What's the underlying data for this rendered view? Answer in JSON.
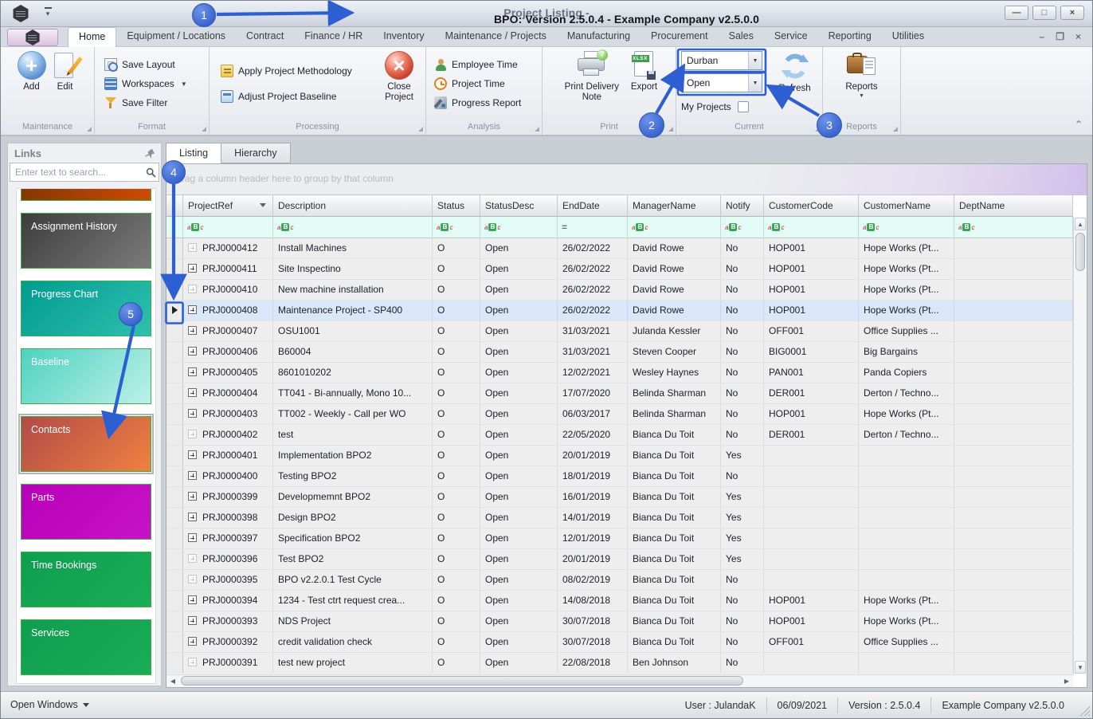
{
  "titlebar": {
    "title_prefix": "Project Listing - ",
    "title_main": "BPO: Version 2.5.0.4 - Example Company v2.5.0.0"
  },
  "ribbon_tabs": [
    {
      "label": "Home",
      "active": true
    },
    {
      "label": "Equipment / Locations"
    },
    {
      "label": "Contract"
    },
    {
      "label": "Finance / HR"
    },
    {
      "label": "Inventory"
    },
    {
      "label": "Maintenance / Projects"
    },
    {
      "label": "Manufacturing"
    },
    {
      "label": "Procurement"
    },
    {
      "label": "Sales"
    },
    {
      "label": "Service"
    },
    {
      "label": "Reporting"
    },
    {
      "label": "Utilities"
    }
  ],
  "ribbon": {
    "maintenance": {
      "label": "Maintenance",
      "add": "Add",
      "edit": "Edit"
    },
    "format": {
      "label": "Format",
      "save_layout": "Save Layout",
      "workspaces": "Workspaces",
      "save_filter": "Save Filter"
    },
    "processing": {
      "label": "Processing",
      "apply": "Apply Project Methodology",
      "adjust": "Adjust Project Baseline",
      "close_project": "Close Project"
    },
    "analysis": {
      "label": "Analysis",
      "employee_time": "Employee Time",
      "project_time": "Project Time",
      "progress_report": "Progress Report"
    },
    "print": {
      "label": "Print",
      "print_delivery": "Print Delivery Note",
      "export": "Export",
      "export_badge": "XLSX"
    },
    "current": {
      "label": "Current",
      "site_value": "Durban",
      "status_value": "Open",
      "my_projects": "My Projects",
      "refresh": "Refresh"
    },
    "reports": {
      "label": "Reports",
      "button": "Reports"
    }
  },
  "sidebar": {
    "title": "Links",
    "search_placeholder": "Enter text to search...",
    "tiles": [
      {
        "label": "",
        "color_from": "#833800",
        "color_to": "#cf4a05",
        "partial": true
      },
      {
        "label": "Assignment History",
        "color_from": "#3d3d3d",
        "color_to": "#7b7b7b"
      },
      {
        "label": "Progress Chart",
        "color_from": "#009c8f",
        "color_to": "#2fbfae"
      },
      {
        "label": "Baseline",
        "color_from": "#4ed2c0",
        "color_to": "#bdf0e8"
      },
      {
        "label": "Contacts",
        "color_from": "#b34a49",
        "color_to": "#ef813f",
        "selected": true
      },
      {
        "label": "Parts",
        "color_from": "#b800b8",
        "color_to": "#c713c7"
      },
      {
        "label": "Time Bookings",
        "color_from": "#0f9e4e",
        "color_to": "#1aac59"
      },
      {
        "label": "Services",
        "color_from": "#0f9e4e",
        "color_to": "#1aac59"
      }
    ]
  },
  "doc_tabs": {
    "listing": "Listing",
    "hierarchy": "Hierarchy"
  },
  "grid": {
    "group_hint": "Drag a column header here to group by that column",
    "columns": [
      {
        "key": "ref",
        "label": "ProjectRef",
        "sorted": true,
        "filter": "abc"
      },
      {
        "key": "desc",
        "label": "Description",
        "filter": "abc"
      },
      {
        "key": "status",
        "label": "Status",
        "filter": "abc"
      },
      {
        "key": "sdesc",
        "label": "StatusDesc",
        "filter": "abc"
      },
      {
        "key": "edate",
        "label": "EndDate",
        "filter": "eq"
      },
      {
        "key": "mgr",
        "label": "ManagerName",
        "filter": "abc"
      },
      {
        "key": "notify",
        "label": "Notify",
        "filter": "abc"
      },
      {
        "key": "ccode",
        "label": "CustomerCode",
        "filter": "abc"
      },
      {
        "key": "cname",
        "label": "CustomerName",
        "filter": "abc"
      },
      {
        "key": "dept",
        "label": "DeptName",
        "filter": "abc"
      }
    ],
    "rows": [
      {
        "expand": "light",
        "ref": "PRJ0000412",
        "desc": "Install Machines",
        "status": "O",
        "sdesc": "Open",
        "edate": "26/02/2022",
        "mgr": "David Rowe",
        "notify": "No",
        "ccode": "HOP001",
        "cname": "Hope Works (Pt...",
        "dept": "",
        "selected": false
      },
      {
        "expand": "dark",
        "ref": "PRJ0000411",
        "desc": "Site Inspectino",
        "status": "O",
        "sdesc": "Open",
        "edate": "26/02/2022",
        "mgr": "David Rowe",
        "notify": "No",
        "ccode": "HOP001",
        "cname": "Hope Works (Pt...",
        "dept": "",
        "selected": false
      },
      {
        "expand": "light",
        "ref": "PRJ0000410",
        "desc": "New machine installation",
        "status": "O",
        "sdesc": "Open",
        "edate": "26/02/2022",
        "mgr": "David Rowe",
        "notify": "No",
        "ccode": "HOP001",
        "cname": "Hope Works (Pt...",
        "dept": "",
        "selected": false
      },
      {
        "expand": "dark",
        "ref": "PRJ0000408",
        "desc": "Maintenance Project - SP400",
        "status": "O",
        "sdesc": "Open",
        "edate": "26/02/2022",
        "mgr": "David Rowe",
        "notify": "No",
        "ccode": "HOP001",
        "cname": "Hope Works (Pt...",
        "dept": "",
        "selected": true
      },
      {
        "expand": "dark",
        "ref": "PRJ0000407",
        "desc": "OSU1001",
        "status": "O",
        "sdesc": "Open",
        "edate": "31/03/2021",
        "mgr": "Julanda Kessler",
        "notify": "No",
        "ccode": "OFF001",
        "cname": "Office Supplies ...",
        "dept": "",
        "selected": false
      },
      {
        "expand": "dark",
        "ref": "PRJ0000406",
        "desc": "B60004",
        "status": "O",
        "sdesc": "Open",
        "edate": "31/03/2021",
        "mgr": "Steven Cooper",
        "notify": "No",
        "ccode": "BIG0001",
        "cname": "Big Bargains",
        "dept": "",
        "selected": false
      },
      {
        "expand": "dark",
        "ref": "PRJ0000405",
        "desc": "8601010202",
        "status": "O",
        "sdesc": "Open",
        "edate": "12/02/2021",
        "mgr": "Wesley Haynes",
        "notify": "No",
        "ccode": "PAN001",
        "cname": "Panda Copiers",
        "dept": "",
        "selected": false
      },
      {
        "expand": "dark",
        "ref": "PRJ0000404",
        "desc": "TT041 - Bi-annually, Mono 10...",
        "status": "O",
        "sdesc": "Open",
        "edate": "17/07/2020",
        "mgr": "Belinda Sharman",
        "notify": "No",
        "ccode": "DER001",
        "cname": "Derton / Techno...",
        "dept": "",
        "selected": false
      },
      {
        "expand": "dark",
        "ref": "PRJ0000403",
        "desc": "TT002 - Weekly - Call per WO",
        "status": "O",
        "sdesc": "Open",
        "edate": "06/03/2017",
        "mgr": "Belinda Sharman",
        "notify": "No",
        "ccode": "HOP001",
        "cname": "Hope Works (Pt...",
        "dept": "",
        "selected": false
      },
      {
        "expand": "light",
        "ref": "PRJ0000402",
        "desc": "test",
        "status": "O",
        "sdesc": "Open",
        "edate": "22/05/2020",
        "mgr": "Bianca Du Toit",
        "notify": "No",
        "ccode": "DER001",
        "cname": "Derton / Techno...",
        "dept": "",
        "selected": false
      },
      {
        "expand": "dark",
        "ref": "PRJ0000401",
        "desc": "Implementation BPO2",
        "status": "O",
        "sdesc": "Open",
        "edate": "20/01/2019",
        "mgr": "Bianca Du Toit",
        "notify": "Yes",
        "ccode": "",
        "cname": "",
        "dept": "",
        "selected": false
      },
      {
        "expand": "dark",
        "ref": "PRJ0000400",
        "desc": "Testing BPO2",
        "status": "O",
        "sdesc": "Open",
        "edate": "18/01/2019",
        "mgr": "Bianca Du Toit",
        "notify": "No",
        "ccode": "",
        "cname": "",
        "dept": "",
        "selected": false
      },
      {
        "expand": "dark",
        "ref": "PRJ0000399",
        "desc": "Developmemnt BPO2",
        "status": "O",
        "sdesc": "Open",
        "edate": "16/01/2019",
        "mgr": "Bianca Du Toit",
        "notify": "Yes",
        "ccode": "",
        "cname": "",
        "dept": "",
        "selected": false
      },
      {
        "expand": "dark",
        "ref": "PRJ0000398",
        "desc": "Design BPO2",
        "status": "O",
        "sdesc": "Open",
        "edate": "14/01/2019",
        "mgr": "Bianca Du Toit",
        "notify": "Yes",
        "ccode": "",
        "cname": "",
        "dept": "",
        "selected": false
      },
      {
        "expand": "dark",
        "ref": "PRJ0000397",
        "desc": "Specification BPO2",
        "status": "O",
        "sdesc": "Open",
        "edate": "12/01/2019",
        "mgr": "Bianca Du Toit",
        "notify": "Yes",
        "ccode": "",
        "cname": "",
        "dept": "",
        "selected": false
      },
      {
        "expand": "light",
        "ref": "PRJ0000396",
        "desc": "Test BPO2",
        "status": "O",
        "sdesc": "Open",
        "edate": "20/01/2019",
        "mgr": "Bianca Du Toit",
        "notify": "Yes",
        "ccode": "",
        "cname": "",
        "dept": "",
        "selected": false
      },
      {
        "expand": "light",
        "ref": "PRJ0000395",
        "desc": "BPO v2.2.0.1 Test Cycle",
        "status": "O",
        "sdesc": "Open",
        "edate": "08/02/2019",
        "mgr": "Bianca Du Toit",
        "notify": "No",
        "ccode": "",
        "cname": "",
        "dept": "",
        "selected": false
      },
      {
        "expand": "dark",
        "ref": "PRJ0000394",
        "desc": "1234 - Test ctrt request crea...",
        "status": "O",
        "sdesc": "Open",
        "edate": "14/08/2018",
        "mgr": "Bianca Du Toit",
        "notify": "No",
        "ccode": "HOP001",
        "cname": "Hope Works (Pt...",
        "dept": "",
        "selected": false
      },
      {
        "expand": "dark",
        "ref": "PRJ0000393",
        "desc": "NDS Project",
        "status": "O",
        "sdesc": "Open",
        "edate": "30/07/2018",
        "mgr": "Bianca Du Toit",
        "notify": "No",
        "ccode": "HOP001",
        "cname": "Hope Works (Pt...",
        "dept": "",
        "selected": false
      },
      {
        "expand": "dark",
        "ref": "PRJ0000392",
        "desc": "credit validation check",
        "status": "O",
        "sdesc": "Open",
        "edate": "30/07/2018",
        "mgr": "Bianca Du Toit",
        "notify": "No",
        "ccode": "OFF001",
        "cname": "Office Supplies ...",
        "dept": "",
        "selected": false
      },
      {
        "expand": "light",
        "ref": "PRJ0000391",
        "desc": "test new project",
        "status": "O",
        "sdesc": "Open",
        "edate": "22/08/2018",
        "mgr": "Ben Johnson",
        "notify": "No",
        "ccode": "",
        "cname": "",
        "dept": "",
        "selected": false
      }
    ]
  },
  "statusbar": {
    "open_windows": "Open Windows",
    "items": [
      "User : JulandaK",
      "06/09/2021",
      "Version : 2.5.0.4",
      "Example Company v2.5.0.0"
    ]
  },
  "callouts": [
    "1",
    "2",
    "3",
    "4",
    "5"
  ],
  "icons": {
    "abc_a": "a",
    "abc_b": "B",
    "abc_c": "c",
    "equals": "="
  },
  "colors": {
    "callout": "#3a66d4",
    "selection": "#d9e7f8",
    "filter_row": "#e2fbf5",
    "tile_border": "#3fae49"
  }
}
